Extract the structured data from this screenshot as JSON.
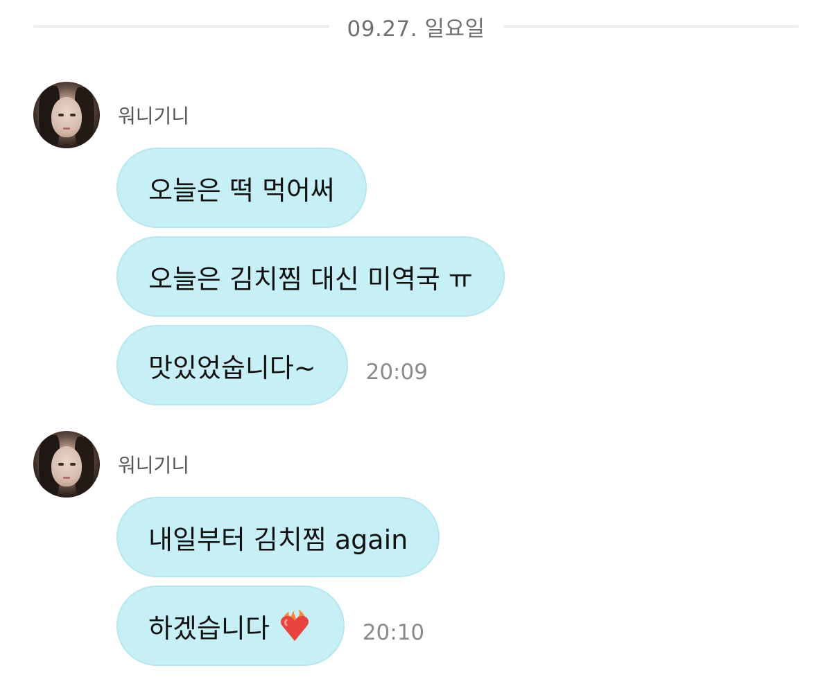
{
  "date_divider": "09.27. 일요일",
  "groups": [
    {
      "sender": "워니기니",
      "avatar": "profile-photo",
      "messages": [
        {
          "text": "오늘은 떡 먹어써"
        },
        {
          "text": "오늘은 김치찜 대신 미역국 ㅠ"
        },
        {
          "text": "맛있었숩니다~",
          "time": "20:09"
        }
      ]
    },
    {
      "sender": "워니기니",
      "avatar": "profile-photo",
      "messages": [
        {
          "text": "내일부터 김치찜 again"
        },
        {
          "text": "하겠습니다",
          "emoji": "heart-on-fire-icon",
          "time": "20:10"
        }
      ]
    }
  ],
  "colors": {
    "bubble": "#c7f0f6",
    "bubble_border": "#b6e6ee",
    "time_text": "#8a8a8a",
    "divider_line": "#ededed"
  }
}
